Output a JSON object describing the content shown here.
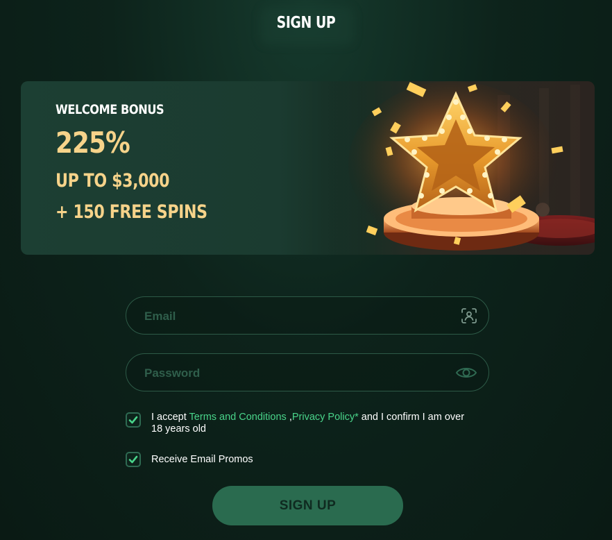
{
  "header": {
    "title": "SIGN UP"
  },
  "banner": {
    "label": "WELCOME BONUS",
    "percent": "225%",
    "up_to": "UP TO $3,000",
    "free_spins": "+ 150 FREE SPINS"
  },
  "form": {
    "email": {
      "value": "",
      "placeholder": "Email",
      "icon": "face-scan-icon"
    },
    "password": {
      "value": "",
      "placeholder": "Password",
      "icon": "eye-icon"
    },
    "terms": {
      "checked": true,
      "prefix": "I accept ",
      "terms_link": "Terms and Conditions",
      "separator": " ,",
      "privacy_link": "Privacy Policy*",
      "suffix": " and I confirm I am over 18 years old"
    },
    "promos": {
      "checked": true,
      "label": "Receive Email Promos"
    },
    "submit_label": "SIGN UP"
  },
  "colors": {
    "background": "#0d231b",
    "banner": "#1c3f33",
    "gold_text": "#f6d38a",
    "link_green": "#49d48a",
    "button": "#2a6b4f",
    "field_border": "#2d5a47"
  }
}
